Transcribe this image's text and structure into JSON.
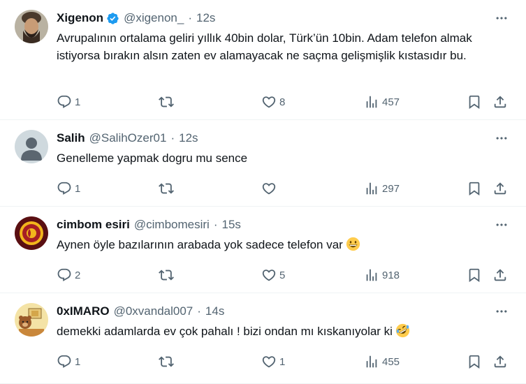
{
  "tweets": [
    {
      "name": "Xigenon",
      "verified": true,
      "handle": "@xigenon_",
      "dot": "·",
      "time": "12s",
      "text": "Avrupalının ortalama geliri yıllık 40bin dolar, Türk’ün 10bin. Adam telefon almak istiyorsa bırakın alsın zaten ev alamayacak ne saçma gelişmişlik kıstasıdır bu.",
      "replies": "1",
      "retweets": "",
      "likes": "8",
      "views": "457",
      "avatar_icon": "warrior-portrait-avatar"
    },
    {
      "name": "Salih",
      "verified": false,
      "handle": "@SalihOzer01",
      "dot": "·",
      "time": "12s",
      "text": "Genelleme yapmak dogru mu sence",
      "replies": "1",
      "retweets": "",
      "likes": "",
      "views": "297",
      "avatar_icon": "default-user-avatar"
    },
    {
      "name": "cimbom esiri",
      "verified": false,
      "handle": "@cimbomesiri",
      "dot": "·",
      "time": "15s",
      "text": "Aynen öyle bazılarının arabada yok sadece telefon var",
      "emoji": "grinning-face-emoji",
      "replies": "2",
      "retweets": "",
      "likes": "5",
      "views": "918",
      "avatar_icon": "galatasaray-crest-avatar"
    },
    {
      "name": "0xIMARO",
      "verified": false,
      "handle": "@0xvandal007",
      "dot": "·",
      "time": "14s",
      "text": "demekki adamlarda ev çok pahalı ! bizi ondan mı kıskanıyolar ki",
      "emoji": "rolling-laughing-emoji",
      "replies": "1",
      "retweets": "",
      "likes": "1",
      "views": "455",
      "avatar_icon": "cartoon-bear-avatar"
    }
  ],
  "colors": {
    "text": "#0f1419",
    "secondary": "#536471",
    "divider": "#eff3f4",
    "verified": "#1d9bf0"
  }
}
